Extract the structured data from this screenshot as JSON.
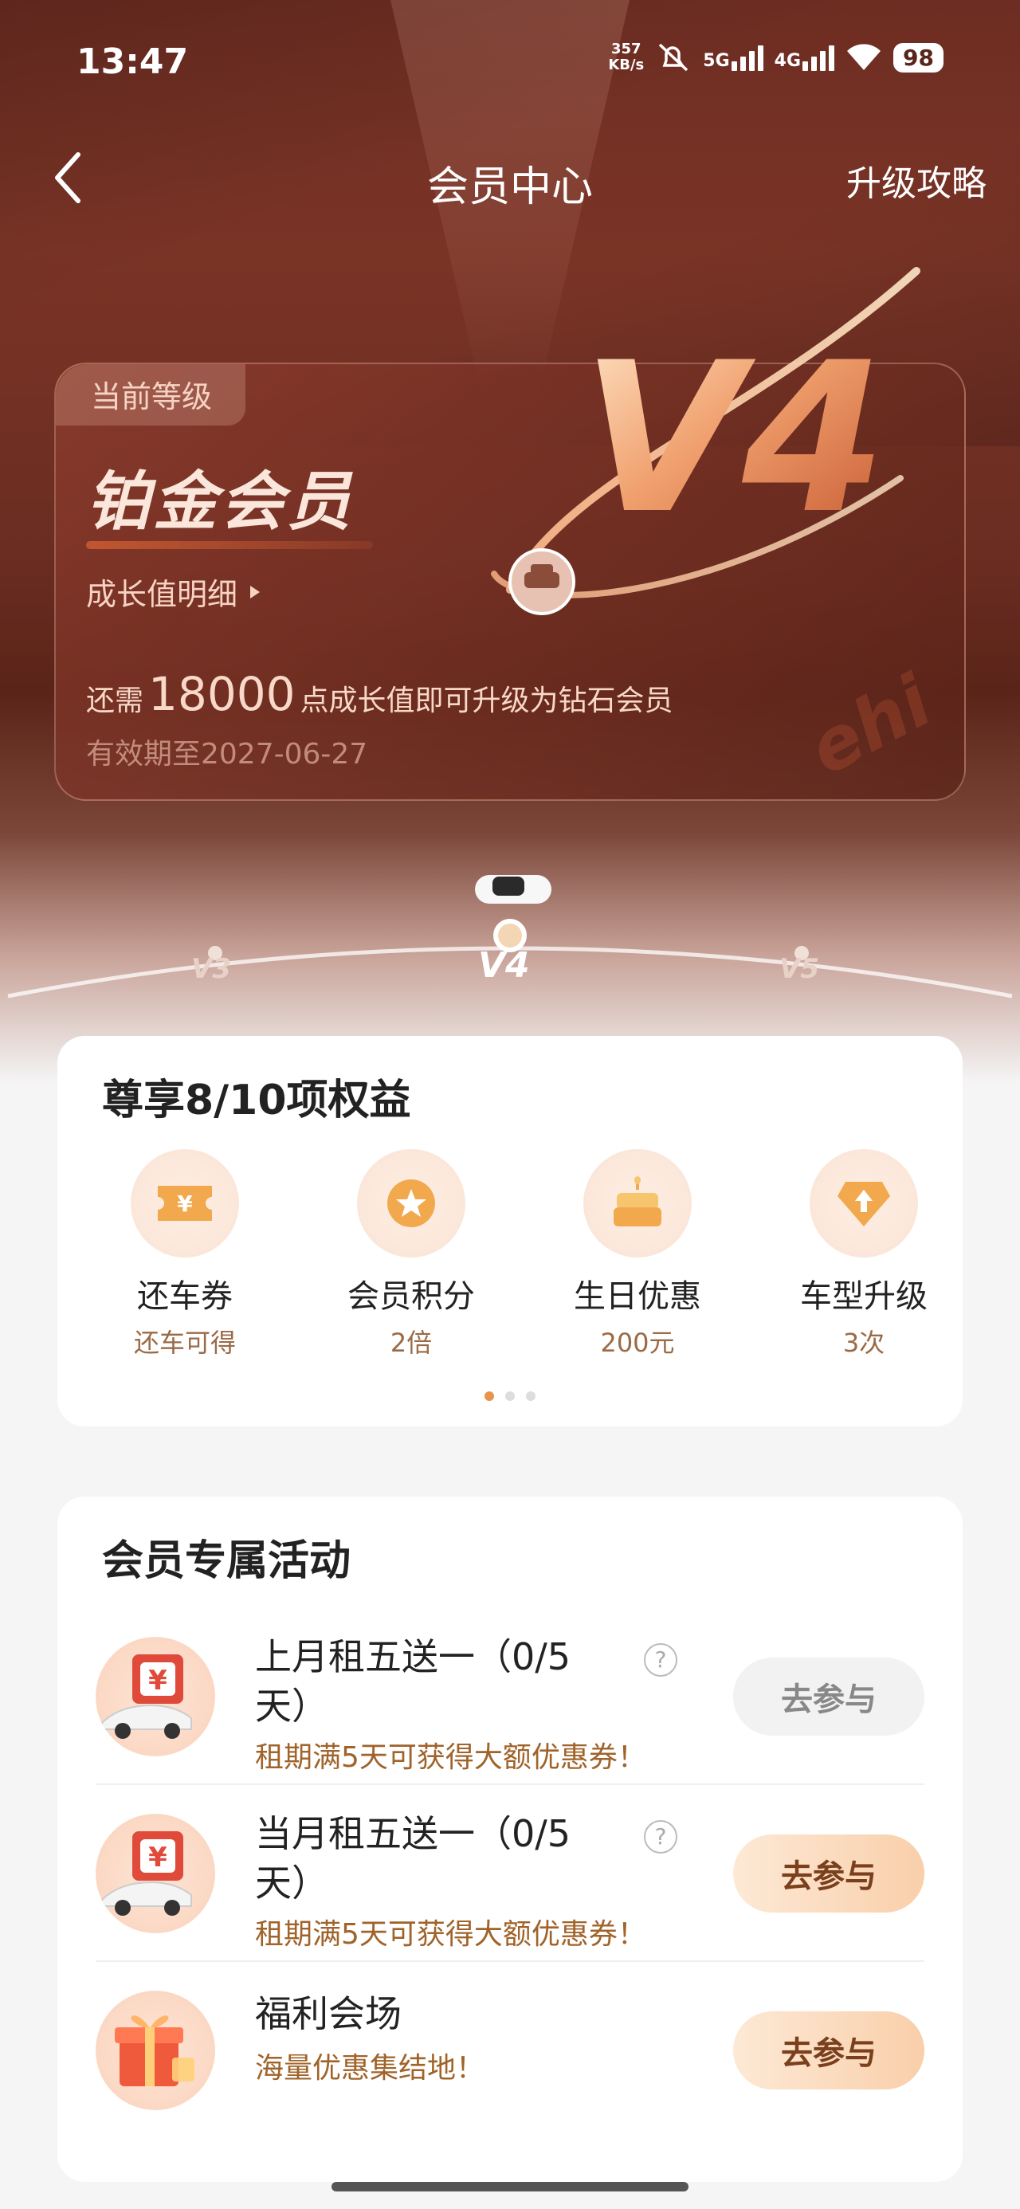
{
  "status_bar": {
    "time": "13:47",
    "net_speed_value": "357",
    "net_speed_unit": "KB/s",
    "sig1": "5G",
    "sig2": "4G",
    "battery": "98"
  },
  "nav": {
    "title": "会员中心",
    "right_link": "升级攻略"
  },
  "member_card": {
    "tag": "当前等级",
    "level_name": "铂金会员",
    "growth_detail": "成长值明细",
    "upgrade_prefix": "还需",
    "upgrade_points": "18000",
    "upgrade_suffix": "点成长值即可升级为钻石会员",
    "valid_until": "有效期至2027-06-27",
    "badge_text": "V4",
    "watermark": "ehi"
  },
  "timeline": {
    "levels": [
      "V3",
      "V4",
      "V5"
    ],
    "current": "V4"
  },
  "benefits": {
    "title": "尊享8/10项权益",
    "items": [
      {
        "label": "还车券",
        "sub": "还车可得",
        "icon": "ticket-icon"
      },
      {
        "label": "会员积分",
        "sub": "2倍",
        "icon": "star-coin-icon"
      },
      {
        "label": "生日优惠",
        "sub": "200元",
        "icon": "cake-icon"
      },
      {
        "label": "车型升级",
        "sub": "3次",
        "icon": "diamond-up-icon"
      }
    ],
    "page_count": 3,
    "current_page": 0
  },
  "activities": {
    "title": "会员专属活动",
    "items": [
      {
        "title": "上月租五送一（0/5天）",
        "subtitle": "租期满5天可获得大额优惠券！",
        "button": "去参与",
        "enabled": false,
        "help": "?"
      },
      {
        "title": "当月租五送一（0/5天）",
        "subtitle": "租期满5天可获得大额优惠券！",
        "button": "去参与",
        "enabled": true,
        "help": "?"
      },
      {
        "title": "福利会场",
        "subtitle": "海量优惠集结地！",
        "button": "去参与",
        "enabled": true
      }
    ]
  },
  "colors": {
    "accent": "#e8944a",
    "hero_bg": "#6e2d22",
    "button_text": "#7a3f1c"
  }
}
